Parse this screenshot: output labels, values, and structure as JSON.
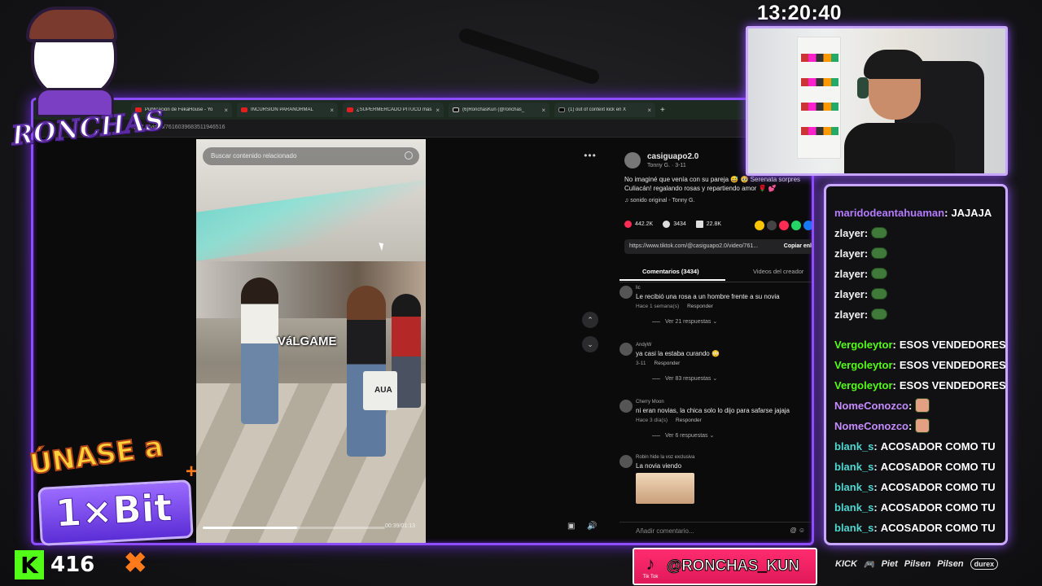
{
  "clock": "13:20:40",
  "logo": {
    "word": "RONCHAS"
  },
  "browser": {
    "tabs": [
      {
        "label": "Publicación de FekaHouse - Yo",
        "fav": "youtube"
      },
      {
        "label": "INCURSIÓN PARANORMAL",
        "fav": "youtube"
      },
      {
        "label": "¿SUPERMERCADO PITUCO más",
        "fav": "youtube"
      },
      {
        "label": "(6)RonchasKun (@ronchas_",
        "fav": "tiktok"
      },
      {
        "label": "(1) out of context kick en X",
        "fav": "x"
      }
    ],
    "new_tab": "+",
    "url": "apo2.0/video/7616039683511946516"
  },
  "video": {
    "search_placeholder": "Buscar contenido relacionado",
    "caption": "VáLGAME",
    "bag_text": "AUA",
    "timecode": "00:39/01:13",
    "progress": 0.52
  },
  "post": {
    "author": "casiguapo2.0",
    "author_sub": "Tonny G. · 3-11",
    "description": "No imaginé que venía con su pareja 😅 🥹 Serenata sorpres Culiacán! regalando rosas y repartiendo amor 🌹 💕",
    "sound": "♫ sonido original - Tonny G.",
    "likes": "442.2K",
    "comments": "3434",
    "saves": "22.8K",
    "link": "https://www.tiktok.com/@casiguapo2.0/video/761...",
    "copy_label": "Copiar enl",
    "tab_comments": "Comentarios (3434)",
    "tab_creator": "Videos del creador",
    "comment_placeholder": "Añadir comentario...",
    "comments_list": [
      {
        "user": "lic",
        "text": "Le recibió una rosa a un hombre frente a su novia",
        "meta": "Hace 1 semana(s)",
        "reply": "Responder",
        "replies": "Ver 21 respuestas ⌄"
      },
      {
        "user": "AndyW",
        "text": "ya casi la estaba curando 😳",
        "meta": "3-11",
        "reply": "Responder",
        "replies": "Ver 83 respuestas ⌄"
      },
      {
        "user": "Cherry Moon",
        "text": "ni eran novias, la chica solo lo dijo para safarse jajaja",
        "meta": "Hace 3 día(s)",
        "reply": "Responder",
        "replies": "Ver 6 respuestas ⌄"
      },
      {
        "user": "Robin hide la voz exclusiva",
        "text": "La novia viendo",
        "meta": "",
        "reply": "",
        "replies": ""
      }
    ]
  },
  "chat": {
    "messages": [
      {
        "user": "maridodeantahuaman",
        "color": "#b57bff",
        "text": "JAJAJA",
        "emote": ""
      },
      {
        "user": "zlayer",
        "color": "#f0f0f0",
        "text": "",
        "emote": "frog"
      },
      {
        "user": "zlayer",
        "color": "#f0f0f0",
        "text": "",
        "emote": "frog"
      },
      {
        "user": "zlayer",
        "color": "#f0f0f0",
        "text": "",
        "emote": "frog"
      },
      {
        "user": "zlayer",
        "color": "#f0f0f0",
        "text": "",
        "emote": "frog"
      },
      {
        "user": "zlayer",
        "color": "#f0f0f0",
        "text": "",
        "emote": "frog"
      },
      {
        "user": "Vergoleytor",
        "color": "#53fc18",
        "text": "ESOS VENDEDORES N",
        "emote": ""
      },
      {
        "user": "Vergoleytor",
        "color": "#53fc18",
        "text": "ESOS VENDEDORES N",
        "emote": ""
      },
      {
        "user": "Vergoleytor",
        "color": "#53fc18",
        "text": "ESOS VENDEDORES N",
        "emote": ""
      },
      {
        "user": "NomeConozco",
        "color": "#c58cff",
        "text": "",
        "emote": "face"
      },
      {
        "user": "NomeConozco",
        "color": "#c58cff",
        "text": "",
        "emote": "face"
      },
      {
        "user": "blank_s",
        "color": "#4fd6d0",
        "text": "ACOSADOR COMO TU",
        "emote": ""
      },
      {
        "user": "blank_s",
        "color": "#4fd6d0",
        "text": "ACOSADOR COMO TU",
        "emote": ""
      },
      {
        "user": "blank_s",
        "color": "#4fd6d0",
        "text": "ACOSADOR COMO TU",
        "emote": ""
      },
      {
        "user": "blank_s",
        "color": "#4fd6d0",
        "text": "ACOSADOR COMO TU",
        "emote": ""
      },
      {
        "user": "blank_s",
        "color": "#4fd6d0",
        "text": "ACOSADOR COMO TU",
        "emote": ""
      }
    ]
  },
  "promo": {
    "line1": "ÚNASE a",
    "brand": "1×Bit",
    "plus": "+"
  },
  "kick": {
    "icon": "K",
    "viewers": "416"
  },
  "tiktok_badge": {
    "small": "Tik Tok",
    "handle": "@RONCHAS_KUN"
  },
  "sponsors": [
    "KICK",
    "🎮",
    "Piet",
    "Pilsen",
    "Pilsen",
    "durex"
  ]
}
